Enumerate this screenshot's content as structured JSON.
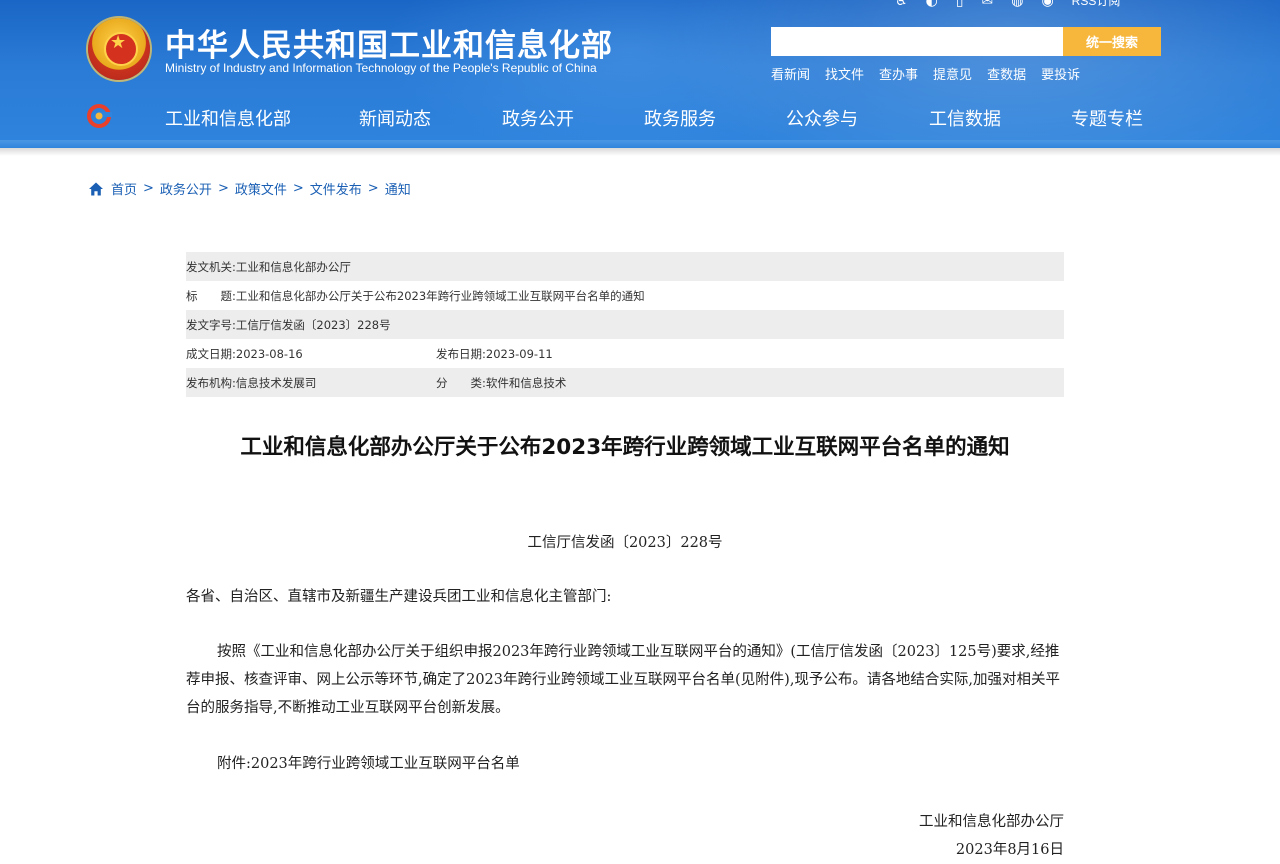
{
  "header": {
    "site_title": "中华人民共和国工业和信息化部",
    "site_subtitle": "Ministry of Industry and Information Technology of the People's Republic of China",
    "rss_label": "RSS订阅",
    "search": {
      "placeholder": "",
      "button_label": "统一搜索"
    },
    "quick_links": [
      "看新闻",
      "找文件",
      "查办事",
      "提意见",
      "查数据",
      "要投诉"
    ]
  },
  "nav": {
    "items": [
      "工业和信息化部",
      "新闻动态",
      "政务公开",
      "政务服务",
      "公众参与",
      "工信数据",
      "专题专栏"
    ]
  },
  "breadcrumb": [
    "首页",
    "政务公开",
    "政策文件",
    "文件发布",
    "通知"
  ],
  "meta": {
    "issuer_label": "发文机关:",
    "issuer": "工业和信息化部办公厅",
    "title_label": "标　　题:",
    "title": "工业和信息化部办公厅关于公布2023年跨行业跨领域工业互联网平台名单的通知",
    "doc_no_label": "发文字号:",
    "doc_no": "工信厅信发函〔2023〕228号",
    "created_label": "成文日期:",
    "created": "2023-08-16",
    "published_label": "发布日期:",
    "published": "2023-09-11",
    "org_label": "发布机构:",
    "org": "信息技术发展司",
    "category_label": "分　　类:",
    "category": "软件和信息技术"
  },
  "article": {
    "title": "工业和信息化部办公厅关于公布2023年跨行业跨领域工业互联网平台名单的通知",
    "doc_no": "工信厅信发函〔2023〕228号",
    "recipient": "各省、自治区、直辖市及新疆生产建设兵团工业和信息化主管部门:",
    "body": "按照《工业和信息化部办公厅关于组织申报2023年跨行业跨领域工业互联网平台的通知》(工信厅信发函〔2023〕125号)要求,经推荐申报、核查评审、网上公示等环节,确定了2023年跨行业跨领域工业互联网平台名单(见附件),现予公布。请各地结合实际,加强对相关平台的服务指导,不断推动工业互联网平台创新发展。",
    "attachment": "附件:2023年跨行业跨领域工业互联网平台名单",
    "sign_org": "工业和信息化部办公厅",
    "sign_date": "2023年8月16日"
  },
  "colors": {
    "header_blue": "#2a7bd6",
    "search_button": "#f6b73c",
    "link_blue": "#1a5fb4",
    "meta_shade": "#ededed"
  }
}
